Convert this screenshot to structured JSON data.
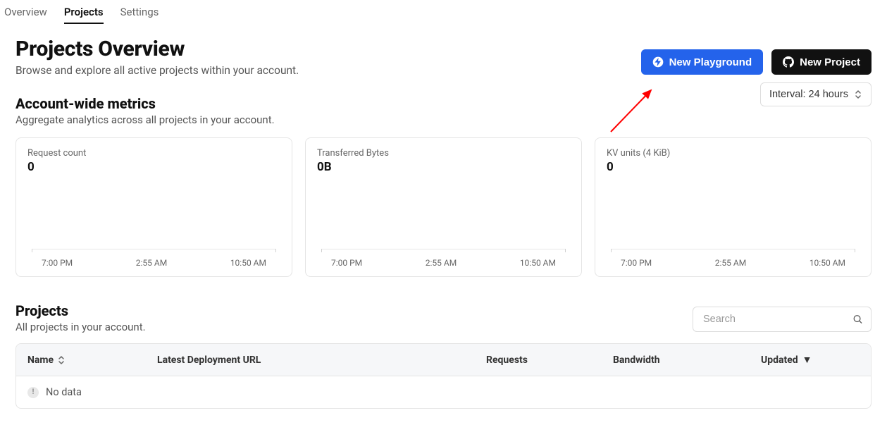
{
  "tabs": {
    "overview": "Overview",
    "projects": "Projects",
    "settings": "Settings",
    "active": "projects"
  },
  "header": {
    "title": "Projects Overview",
    "subtitle": "Browse and explore all active projects within your account.",
    "new_playground": "New Playground",
    "new_project": "New Project"
  },
  "metrics_section": {
    "title": "Account-wide metrics",
    "subtitle": "Aggregate analytics across all projects in your account.",
    "interval_label": "Interval: 24 hours"
  },
  "metrics": [
    {
      "label": "Request count",
      "value": "0"
    },
    {
      "label": "Transferred Bytes",
      "value": "0B"
    },
    {
      "label": "KV units (4 KiB)",
      "value": "0"
    }
  ],
  "chart_axis": [
    "7:00 PM",
    "2:55 AM",
    "10:50 AM"
  ],
  "chart_data": [
    {
      "type": "line",
      "title": "Request count",
      "x": [
        "7:00 PM",
        "2:55 AM",
        "10:50 AM"
      ],
      "values": [
        0,
        0,
        0
      ],
      "ylim": [
        0,
        1
      ]
    },
    {
      "type": "line",
      "title": "Transferred Bytes",
      "x": [
        "7:00 PM",
        "2:55 AM",
        "10:50 AM"
      ],
      "values": [
        0,
        0,
        0
      ],
      "ylim": [
        0,
        1
      ]
    },
    {
      "type": "line",
      "title": "KV units (4 KiB)",
      "x": [
        "7:00 PM",
        "2:55 AM",
        "10:50 AM"
      ],
      "values": [
        0,
        0,
        0
      ],
      "ylim": [
        0,
        1
      ]
    }
  ],
  "projects_section": {
    "title": "Projects",
    "subtitle": "All projects in your account.",
    "search_placeholder": "Search"
  },
  "table": {
    "columns": {
      "name": "Name",
      "url": "Latest Deployment URL",
      "requests": "Requests",
      "bandwidth": "Bandwidth",
      "updated": "Updated"
    },
    "empty": "No data"
  }
}
